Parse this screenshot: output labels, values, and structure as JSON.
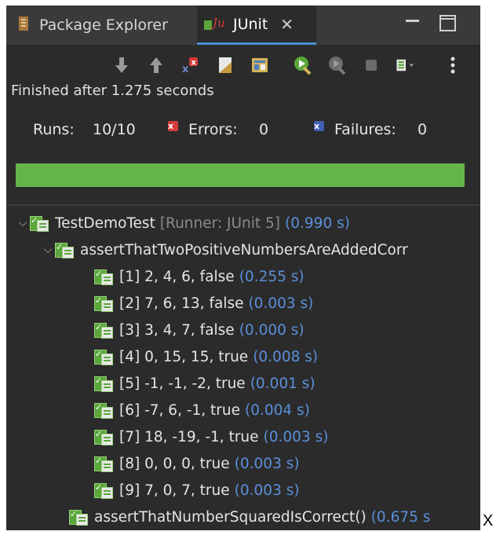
{
  "tabs": [
    {
      "label": "Package Explorer",
      "icon": "package-explorer-icon",
      "active": false
    },
    {
      "label": "JUnit",
      "icon": "junit-icon",
      "active": true,
      "close": "✕"
    }
  ],
  "status_text": "Finished after 1.275 seconds",
  "counters": {
    "runs_label": "Runs:",
    "runs_value": "10/10",
    "errors_label": "Errors:",
    "errors_value": "0",
    "failures_label": "Failures:",
    "failures_value": "0"
  },
  "progress": {
    "fraction": 1.0,
    "color": "#63b54a"
  },
  "tree": {
    "root": {
      "label": "TestDemoTest",
      "runner": "[Runner: JUnit 5]",
      "time": "(0.990 s)"
    },
    "method1": {
      "label": "assertThatTwoPositiveNumbersAreAddedCorr"
    },
    "cases": [
      {
        "label": "[1] 2, 4, 6, false",
        "time": "(0.255 s)"
      },
      {
        "label": "[2] 7, 6, 13, false",
        "time": "(0.003 s)"
      },
      {
        "label": "[3] 3, 4, 7, false",
        "time": "(0.000 s)"
      },
      {
        "label": "[4] 0, 15, 15, true",
        "time": "(0.008 s)"
      },
      {
        "label": "[5] -1, -1, -2, true",
        "time": "(0.001 s)"
      },
      {
        "label": "[6] -7, 6, -1, true",
        "time": "(0.004 s)"
      },
      {
        "label": "[7] 18, -19, -1, true",
        "time": "(0.003 s)"
      },
      {
        "label": "[8] 0, 0, 0, true",
        "time": "(0.003 s)"
      },
      {
        "label": "[9] 7, 0, 7, true",
        "time": "(0.003 s)"
      }
    ],
    "method2": {
      "label": "assertThatNumberSquaredIsCorrect()",
      "time": "(0.675 s"
    }
  },
  "colors": {
    "panel_bg": "#2b2b2b",
    "time_blue": "#5a8fd8",
    "pass_green": "#63b54a",
    "error_red": "#d33a3a"
  },
  "stray_text": "X"
}
